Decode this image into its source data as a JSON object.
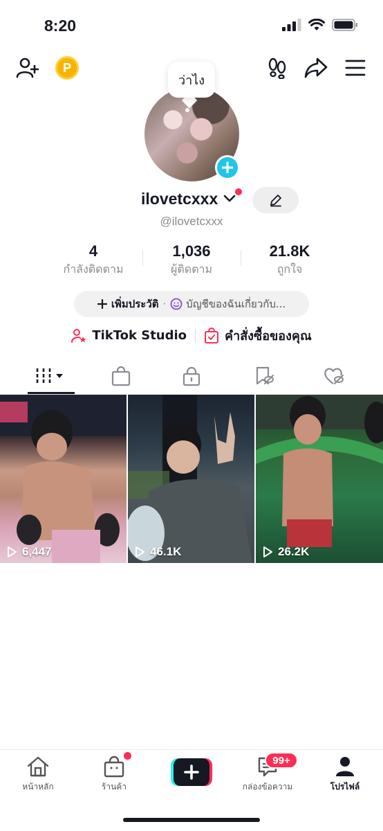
{
  "status_bar": {
    "time": "8:20"
  },
  "header": {
    "add_friend_icon": "person-plus-icon",
    "coin_label": "P",
    "footprints_icon": "footprints-icon",
    "share_icon": "share-arrow-icon",
    "menu_icon": "hamburger-menu-icon"
  },
  "profile": {
    "note_bubble": "ว่าไง",
    "username": "ilovetcxxx",
    "handle": "@ilovetcxxx",
    "stats": [
      {
        "value": "4",
        "label": "กำลังติดตาม"
      },
      {
        "value": "1,036",
        "label": "ผู้ติดตาม"
      },
      {
        "value": "21.8K",
        "label": "ถูกใจ"
      }
    ],
    "bio_add": "เพิ่มประวัติ",
    "bio_separator": "·",
    "bio_text": "บัญชีของฉันเกี่ยวกับ...",
    "studio_label": "TikTok Studio",
    "orders_label": "คำสั่งซื้อของคุณ"
  },
  "tabs": [
    {
      "icon": "grid-icon",
      "active": true
    },
    {
      "icon": "shopping-bag-icon"
    },
    {
      "icon": "lock-icon"
    },
    {
      "icon": "bookmark-hidden-icon"
    },
    {
      "icon": "heart-hidden-icon"
    }
  ],
  "videos": [
    {
      "views": "6,447"
    },
    {
      "views": "46.1K"
    },
    {
      "views": "26.2K"
    }
  ],
  "bottom_nav": {
    "home": "หน้าหลัก",
    "shop": "ร้านค้า",
    "inbox": "กล่องข้อความ",
    "inbox_badge": "99+",
    "profile": "โปรไฟล์"
  },
  "colors": {
    "accent_red": "#fe2c55",
    "accent_cyan": "#20c6e8",
    "coin_gold": "#f6b400",
    "text_primary": "#161823",
    "text_secondary": "#8a8b91"
  }
}
